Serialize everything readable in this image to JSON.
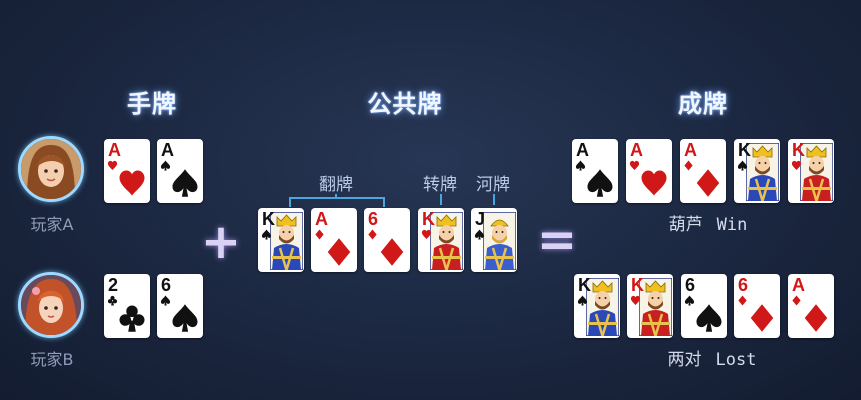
{
  "headings": {
    "hand": "手牌",
    "community": "公共牌",
    "result": "成牌"
  },
  "players": [
    {
      "name": "玩家A",
      "avatar": "girl-avatar-a"
    },
    {
      "name": "玩家B",
      "avatar": "girl-avatar-b"
    }
  ],
  "hand_cards": {
    "a": [
      {
        "rank": "A",
        "suit": "hearts"
      },
      {
        "rank": "A",
        "suit": "spades"
      }
    ],
    "b": [
      {
        "rank": "2",
        "suit": "clubs"
      },
      {
        "rank": "6",
        "suit": "spades"
      }
    ]
  },
  "community_labels": {
    "flop": "翻牌",
    "turn": "转牌",
    "river": "河牌"
  },
  "community_cards": [
    {
      "rank": "K",
      "suit": "spades"
    },
    {
      "rank": "A",
      "suit": "diamonds"
    },
    {
      "rank": "6",
      "suit": "diamonds"
    },
    {
      "rank": "K",
      "suit": "hearts"
    },
    {
      "rank": "J",
      "suit": "spades"
    }
  ],
  "operators": {
    "plus": "+",
    "equals": "="
  },
  "results": {
    "a": {
      "cards": [
        {
          "rank": "A",
          "suit": "spades"
        },
        {
          "rank": "A",
          "suit": "hearts"
        },
        {
          "rank": "A",
          "suit": "diamonds"
        },
        {
          "rank": "K",
          "suit": "spades"
        },
        {
          "rank": "K",
          "suit": "hearts"
        }
      ],
      "hand_name": "葫芦",
      "outcome": "Win"
    },
    "b": {
      "cards": [
        {
          "rank": "K",
          "suit": "spades"
        },
        {
          "rank": "K",
          "suit": "hearts"
        },
        {
          "rank": "6",
          "suit": "spades"
        },
        {
          "rank": "6",
          "suit": "diamonds"
        },
        {
          "rank": "A",
          "suit": "diamonds"
        }
      ],
      "hand_name": "两对",
      "outcome": "Lost"
    }
  },
  "colors": {
    "red_suit": "#d01818",
    "black_suit": "#111111",
    "heading_glow": "#78aaff",
    "bracket": "#4aa6e0"
  }
}
